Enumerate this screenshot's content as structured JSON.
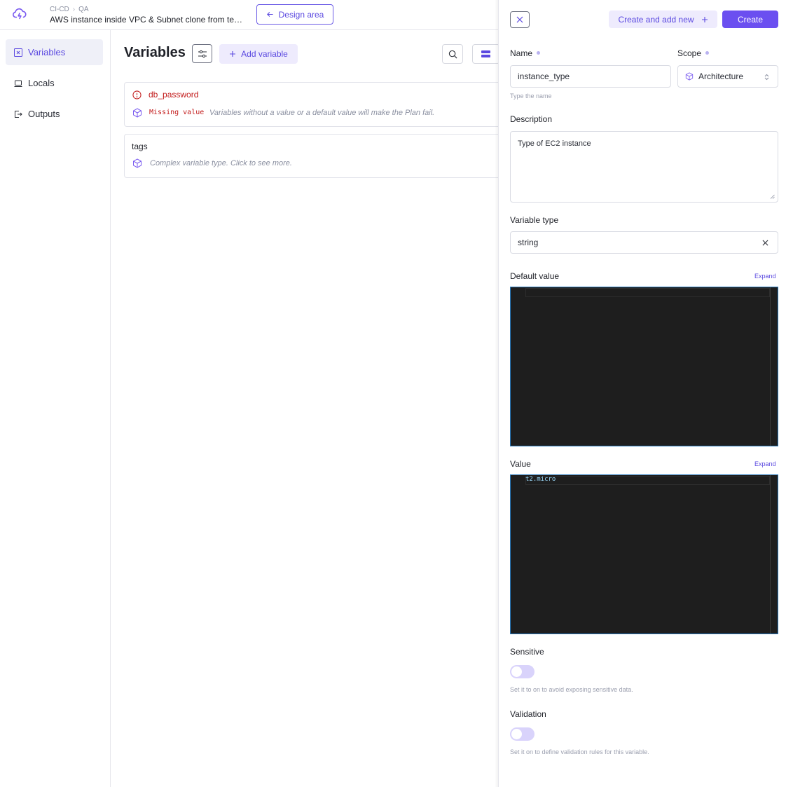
{
  "topbar": {
    "breadcrumb": [
      "CI-CD",
      "QA"
    ],
    "project_title": "AWS instance inside VPC & Subnet clone from tem...",
    "design_area_label": "Design area"
  },
  "sidebar": {
    "items": [
      {
        "label": "Variables",
        "icon": "variable-icon",
        "active": true
      },
      {
        "label": "Locals",
        "icon": "laptop-icon",
        "active": false
      },
      {
        "label": "Outputs",
        "icon": "export-icon",
        "active": false
      }
    ]
  },
  "main": {
    "title": "Variables",
    "add_variable_label": "Add variable",
    "variables": [
      {
        "name": "db_password",
        "status": "Missing value",
        "hint": "Variables without a value or a default value will make the Plan fail."
      },
      {
        "name": "tags",
        "hint": "Complex variable type. Click to see more."
      }
    ]
  },
  "drawer": {
    "create_and_add_new_label": "Create and add new",
    "create_label": "Create",
    "name_label": "Name",
    "name_value": "instance_type",
    "name_help": "Type the name",
    "scope_label": "Scope",
    "scope_value": "Architecture",
    "description_label": "Description",
    "description_value": "Type of EC2 instance",
    "variable_type_label": "Variable type",
    "variable_type_value": "string",
    "default_value_label": "Default value",
    "default_expand_label": "Expand",
    "value_label": "Value",
    "value_expand_label": "Expand",
    "value_code": "t2.micro",
    "sensitive_label": "Sensitive",
    "sensitive_help": "Set it to on to avoid exposing sensitive data.",
    "validation_label": "Validation",
    "validation_help": "Set it on to define validation rules for this variable."
  },
  "colors": {
    "accent": "#6b4ff0",
    "accent_text": "#5a48e0",
    "accent_light": "#eeebfd",
    "error": "#c21a1a",
    "editor_bg": "#1e1e1e"
  }
}
